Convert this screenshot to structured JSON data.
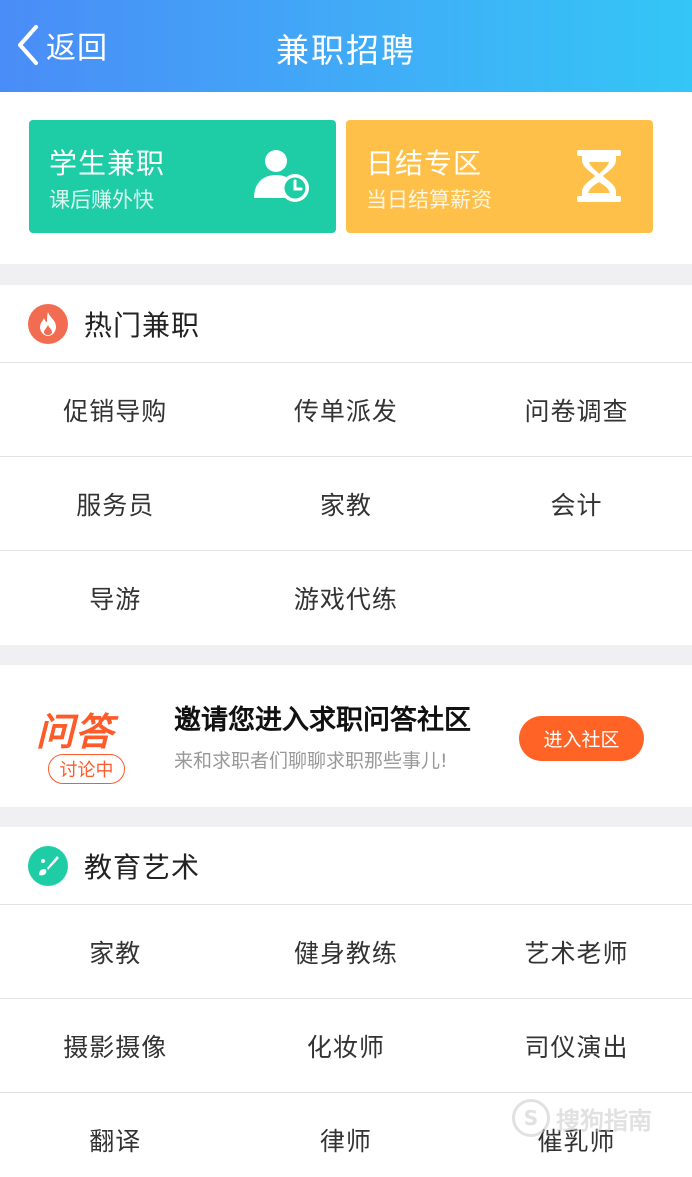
{
  "header": {
    "back_label": "返回",
    "title": "兼职招聘"
  },
  "cards": [
    {
      "title": "学生兼职",
      "subtitle": "课后赚外快",
      "icon": "student-clock-icon",
      "color": "#1ecda5"
    },
    {
      "title": "日结专区",
      "subtitle": "当日结算薪资",
      "icon": "hourglass-icon",
      "color": "#ffc04a"
    }
  ],
  "hot": {
    "title": "热门兼职",
    "icon": "fire-icon",
    "items": [
      [
        "促销导购",
        "传单派发",
        "问卷调查"
      ],
      [
        "服务员",
        "家教",
        "会计"
      ],
      [
        "导游",
        "游戏代练",
        ""
      ]
    ]
  },
  "qa": {
    "logo": "问答",
    "badge": "讨论中",
    "title": "邀请您进入求职问答社区",
    "subtitle": "来和求职者们聊聊求职那些事儿!",
    "button": "进入社区"
  },
  "edu": {
    "title": "教育艺术",
    "icon": "palette-icon",
    "items": [
      [
        "家教",
        "健身教练",
        "艺术老师"
      ],
      [
        "摄影摄像",
        "化妆师",
        "司仪演出"
      ],
      [
        "翻译",
        "律师",
        "催乳师"
      ]
    ]
  },
  "watermark": {
    "text": "搜狗指南"
  }
}
